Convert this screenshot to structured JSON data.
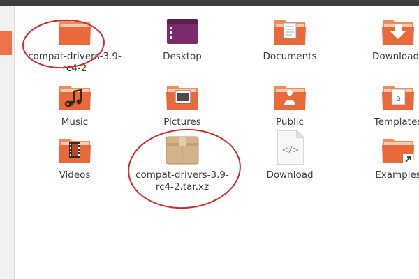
{
  "files": [
    {
      "label": "compat-drivers-3.9-\nrc4-2",
      "type": "folder",
      "icon": "folder-icon",
      "highlighted": true
    },
    {
      "label": "Desktop",
      "type": "desktop",
      "icon": "desktop-folder-icon"
    },
    {
      "label": "Documents",
      "type": "documents",
      "icon": "documents-folder-icon"
    },
    {
      "label": "Downloads",
      "type": "downloads",
      "icon": "downloads-folder-icon"
    },
    {
      "label": "Music",
      "type": "music",
      "icon": "music-folder-icon"
    },
    {
      "label": "Pictures",
      "type": "pictures",
      "icon": "pictures-folder-icon"
    },
    {
      "label": "Public",
      "type": "public",
      "icon": "public-folder-icon"
    },
    {
      "label": "Templates",
      "type": "templates",
      "icon": "templates-folder-icon"
    },
    {
      "label": "Videos",
      "type": "videos",
      "icon": "videos-folder-icon"
    },
    {
      "label": "compat-drivers-3.9-\nrc4-2.tar.xz",
      "type": "archive",
      "icon": "archive-icon",
      "highlighted": true
    },
    {
      "label": "Download",
      "type": "html",
      "icon": "html-file-icon"
    },
    {
      "label": "Examples",
      "type": "examples",
      "icon": "examples-link-icon"
    }
  ],
  "colors": {
    "folder_top": "#f38b56",
    "folder_front": "#e9693b",
    "annotation": "#d8262c",
    "sidebar_accent": "#f0744b",
    "titlebar": "#3d3d3d"
  }
}
